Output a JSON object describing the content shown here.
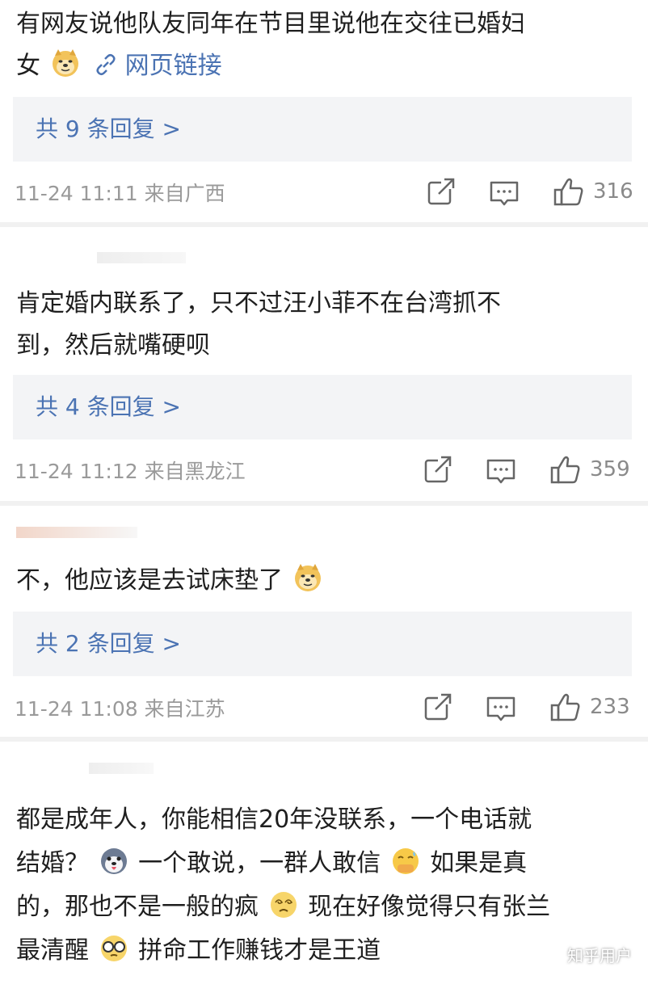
{
  "comments": [
    {
      "text_lines": [
        "有网友说他队友同年在节目里说他在交往已婚妇",
        "女"
      ],
      "link_text": "网页链接",
      "replies": "共 9 条回复 >",
      "meta": "11-24 11:11  来自广西",
      "likes": "316",
      "emoji": "doge-icon"
    },
    {
      "text_lines": [
        "肯定婚内联系了，只不过汪小菲不在台湾抓不",
        "到，然后就嘴硬呗"
      ],
      "replies": "共 4 条回复 >",
      "meta": "11-24 11:12  来自黑龙江",
      "likes": "359"
    },
    {
      "text": "不，他应该是去试床垫了",
      "replies": "共 2 条回复 >",
      "meta": "11-24 11:08  来自江苏",
      "likes": "233",
      "emoji": "doge-icon"
    },
    {
      "line1": "都是成年人，你能相信20年没联系，一个电话就",
      "line2a": "结婚？",
      "line2b": "一个敢说，一群人敢信",
      "line2c": "如果是真",
      "line3a": "的，那也不是一般的疯",
      "line3b": "现在好像觉得只有张兰",
      "line4a": "最清醒",
      "line4b": "拼命工作赚钱才是王道"
    }
  ],
  "watermark": "知乎用户",
  "colors": {
    "link": "#4b73b3",
    "meta": "#9a9a9a",
    "reply_bg": "#f3f4f6"
  },
  "icons": [
    "share-icon",
    "comment-icon",
    "thumbs-up-icon",
    "link-icon",
    "doge-icon",
    "husky-icon",
    "cold-sweat-icon",
    "dizzy-icon",
    "glasses-icon"
  ]
}
